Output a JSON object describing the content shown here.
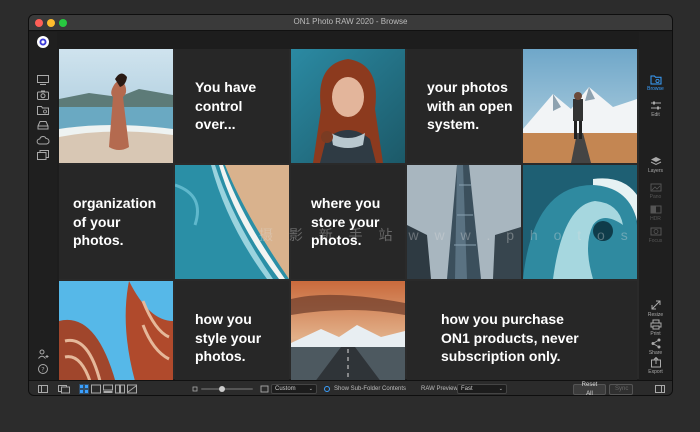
{
  "window": {
    "title": "ON1 Photo RAW 2020 - Browse"
  },
  "right_panel": {
    "browse": "Browse",
    "edit": "Edit",
    "layers": "Layers",
    "pano": "Pano",
    "hdr": "HDR",
    "focus": "Focus",
    "resize": "Resize",
    "print": "Print",
    "share": "Share",
    "export": "Export"
  },
  "tiles": {
    "t1": "You have\ncontrol\nover...",
    "t2": "your photos\nwith an open\nsystem.",
    "t3": "organization\nof your\nphotos.",
    "t4": "where you\nstore your\nphotos.",
    "t5": "how you\nstyle your\nphotos.",
    "t6": "how you purchase\nON1 products, never\nsubscription only."
  },
  "watermark": "摄 影 新 手 站  w w w . p h o t o s   .   p",
  "bottom": {
    "size_select": "Custom",
    "subfolder_label": "Show Sub-Folder Contents",
    "raw_previews_label": "RAW Previews",
    "raw_previews_value": "Fast",
    "reset_all": "Reset All",
    "sync": "Sync"
  },
  "colors": {
    "accent": "#3aa0ff",
    "close": "#ff5f57",
    "minimize": "#febc2e",
    "zoom": "#28c840"
  }
}
